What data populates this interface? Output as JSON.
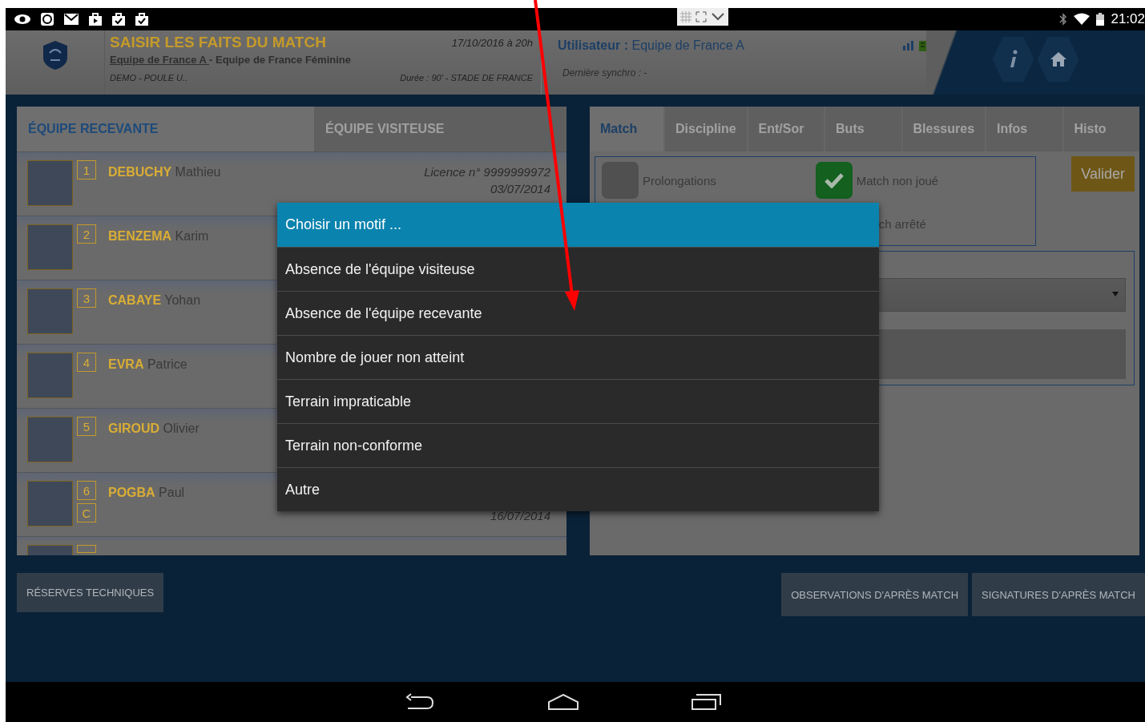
{
  "status_bar": {
    "time": "21:02"
  },
  "header": {
    "title": "SAISIR LES FAITS DU MATCH",
    "home_team": "Equipe de France A ",
    "away_team": " - Equipe de France Féminine",
    "date": "17/10/2016 à 20h",
    "competition": "DEMO - POULE U..",
    "details": "Durée : 90' - STADE DE FRANCE",
    "user_label": "Utilisateur :",
    "user": "Equipe de France A",
    "last_sync": "Dernière synchro : -"
  },
  "team_tabs": [
    {
      "label": "ÉQUIPE RECEVANTE",
      "selected": true
    },
    {
      "label": "ÉQUIPE VISITEUSE",
      "selected": false
    }
  ],
  "players": [
    {
      "number": "1",
      "captain": false,
      "last_name": "DEBUCHY",
      "first_name": "Mathieu",
      "licence": "Licence n° 9999999972",
      "date": "03/07/2014"
    },
    {
      "number": "2",
      "captain": false,
      "last_name": "BENZEMA",
      "first_name": "Karim"
    },
    {
      "number": "3",
      "captain": false,
      "last_name": "CABAYE",
      "first_name": "Yohan"
    },
    {
      "number": "4",
      "captain": false,
      "last_name": "EVRA",
      "first_name": "Patrice"
    },
    {
      "number": "5",
      "captain": false,
      "last_name": "GIROUD",
      "first_name": "Olivier"
    },
    {
      "number": "6",
      "captain": true,
      "captain_mark": "C",
      "last_name": "POGBA",
      "first_name": "Paul",
      "date": "16/07/2014"
    }
  ],
  "match_tabs": [
    {
      "label": "Match",
      "selected": true
    },
    {
      "label": "Discipline",
      "selected": false
    },
    {
      "label": "Ent/Sor",
      "selected": false
    },
    {
      "label": "Buts",
      "selected": false
    },
    {
      "label": "Blessures",
      "selected": false
    },
    {
      "label": "Infos",
      "selected": false
    },
    {
      "label": "Histo",
      "selected": false
    }
  ],
  "options": [
    {
      "label": "Prolongations",
      "checked": false
    },
    {
      "label": "Match non joué",
      "checked": true
    },
    {
      "label": "ch arrêté"
    }
  ],
  "validate_button": "Valider",
  "dialog": {
    "title": "Choisir un motif ...",
    "options": [
      "Absence de l'équipe visiteuse",
      "Absence de l'équipe recevante",
      "Nombre de jouer non atteint",
      "Terrain impraticable",
      "Terrain non-conforme",
      "Autre"
    ]
  },
  "bottom_left_buttons": [
    "RÉSERVES TECHNIQUES"
  ],
  "bottom_right_buttons": [
    "OBSERVATIONS D'APRÈS MATCH",
    "SIGNATURES D'APRÈS MATCH"
  ]
}
